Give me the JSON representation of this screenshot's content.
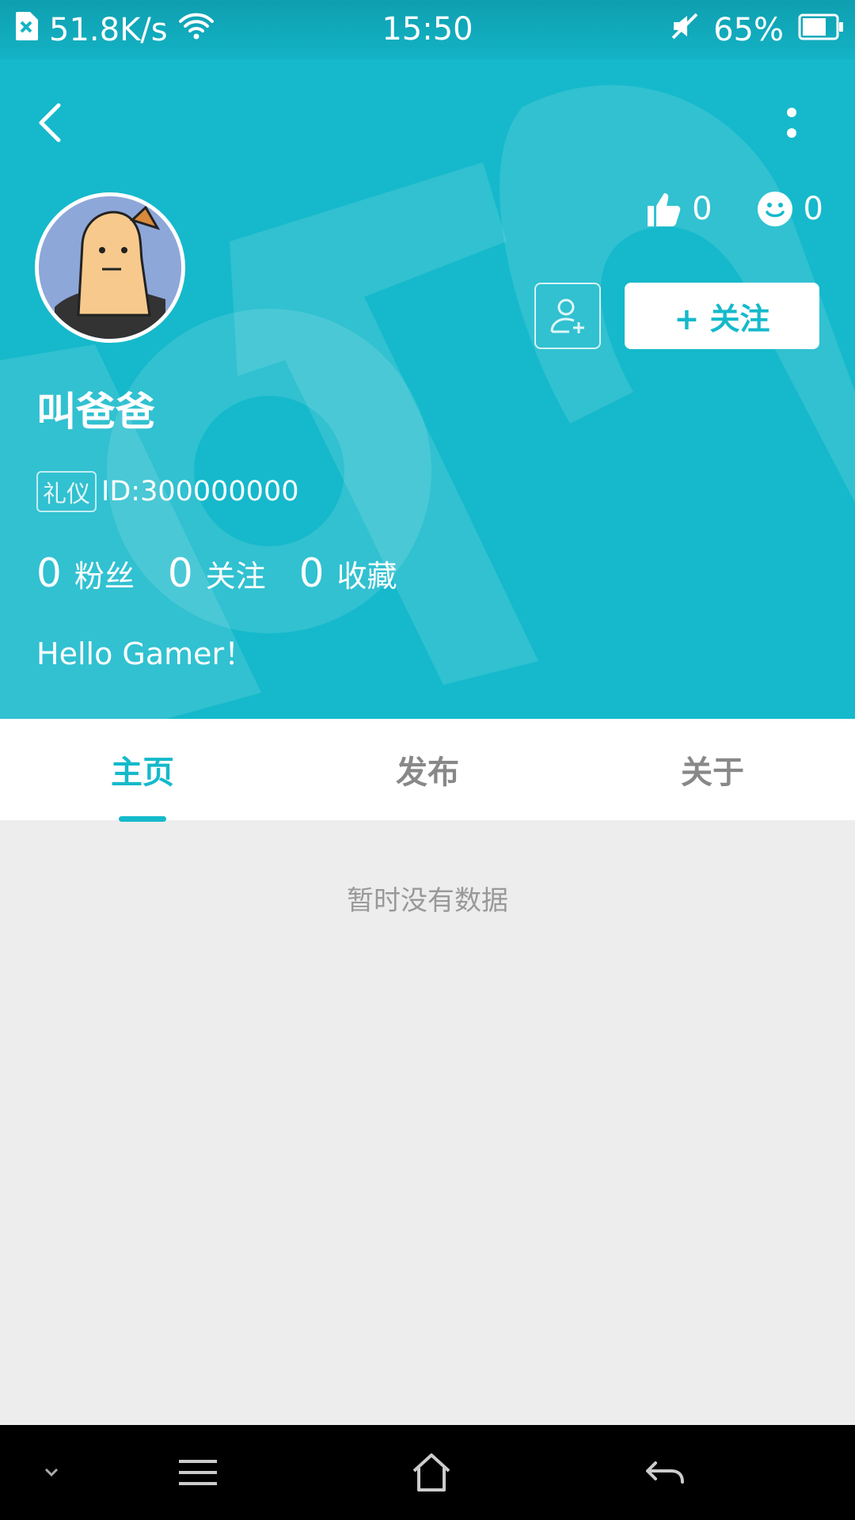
{
  "status_bar": {
    "network_speed": "51.8K/s",
    "time": "15:50",
    "battery": "65%"
  },
  "header": {
    "likes_count": "0",
    "smile_count": "0",
    "follow_button": "+ 关注",
    "username": "叫爸爸",
    "badge": "礼仪",
    "user_id": "ID:300000000",
    "stats": [
      {
        "value": "0",
        "label": "粉丝"
      },
      {
        "value": "0",
        "label": "关注"
      },
      {
        "value": "0",
        "label": "收藏"
      }
    ],
    "bio": "Hello Gamer！"
  },
  "tabs": [
    {
      "label": "主页",
      "active": true
    },
    {
      "label": "发布",
      "active": false
    },
    {
      "label": "关于",
      "active": false
    }
  ],
  "content": {
    "empty_message": "暂时没有数据"
  },
  "colors": {
    "accent": "#15b9cb",
    "background": "#ededed"
  }
}
